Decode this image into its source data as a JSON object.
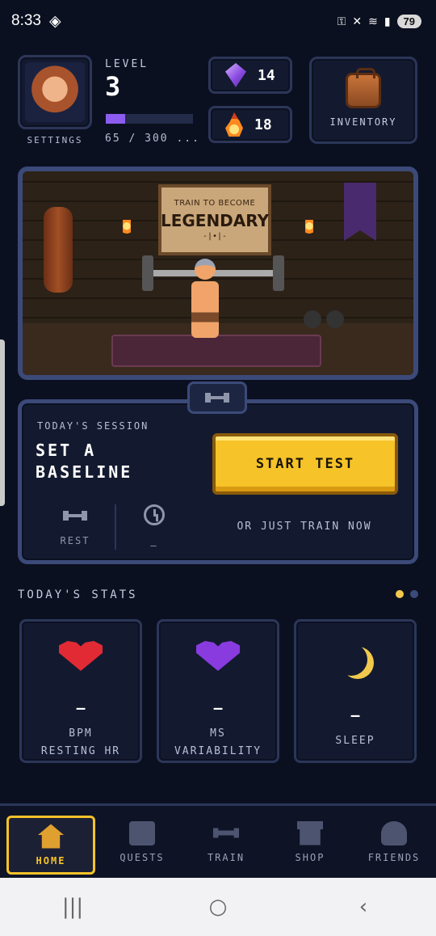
{
  "status_bar": {
    "time": "8:33",
    "battery": "79"
  },
  "profile": {
    "settings_label": "SETTINGS",
    "level_label": "LEVEL",
    "level": "3",
    "xp_text": "65 / 300 ...",
    "xp_progress": 0.22
  },
  "currency": {
    "gems": "14",
    "streak": "18"
  },
  "inventory": {
    "label": "INVENTORY"
  },
  "scene": {
    "banner_small": "TRAIN TO BECOME",
    "banner_big": "LEGENDARY",
    "banner_deco": "-|•|-"
  },
  "session": {
    "label": "TODAY'S SESSION",
    "title": "SET A BASELINE",
    "start_button": "START TEST",
    "rest_value": "",
    "rest_label": "REST",
    "time_value": "—",
    "train_now": "OR JUST TRAIN NOW"
  },
  "stats": {
    "title": "TODAY'S STATS",
    "page_dots": {
      "active": "#f2c94c",
      "inactive": "#3b4a78"
    },
    "cards": [
      {
        "icon": "heart-rate-icon",
        "value": "—",
        "label": "BPM",
        "sublabel": "RESTING HR"
      },
      {
        "icon": "hrv-heart-icon",
        "value": "—",
        "label": "MS",
        "sublabel": "VARIABILITY"
      },
      {
        "icon": "moon-icon",
        "value": "—",
        "label": "SLEEP",
        "sublabel": ""
      }
    ]
  },
  "nav": {
    "items": [
      {
        "label": "HOME",
        "icon": "home-icon",
        "active": true
      },
      {
        "label": "QUESTS",
        "icon": "scroll-icon",
        "active": false
      },
      {
        "label": "TRAIN",
        "icon": "dumbbell-icon",
        "active": false
      },
      {
        "label": "SHOP",
        "icon": "shop-icon",
        "active": false
      },
      {
        "label": "FRIENDS",
        "icon": "friends-icon",
        "active": false
      }
    ]
  },
  "colors": {
    "accent": "#f6c328",
    "xp": "#8c5cf0",
    "background": "#0b1020"
  }
}
